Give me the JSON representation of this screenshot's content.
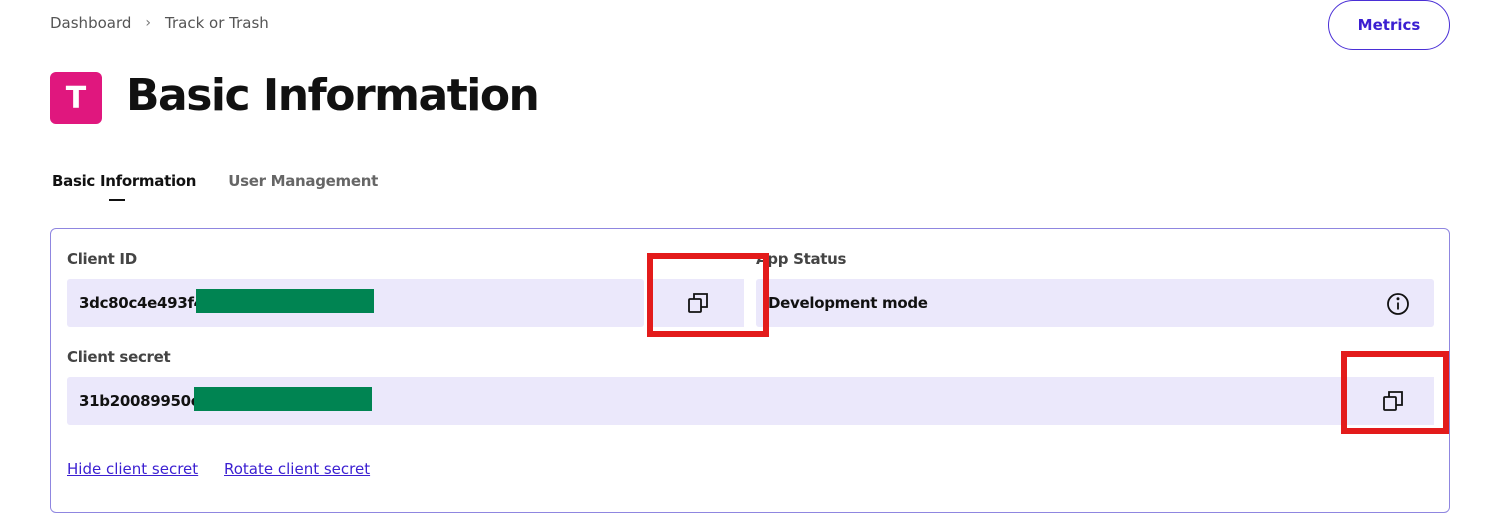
{
  "breadcrumb": {
    "items": [
      "Dashboard",
      "Track or Trash"
    ],
    "separator": "›"
  },
  "header": {
    "metrics_label": "Metrics",
    "app_initial": "T",
    "title": "Basic Information"
  },
  "tabs": [
    {
      "label": "Basic Information",
      "active": true
    },
    {
      "label": "User Management",
      "active": false
    }
  ],
  "fields": {
    "client_id": {
      "label": "Client ID",
      "value": "3dc80c4e493f4"
    },
    "app_status": {
      "label": "App Status",
      "value": "Development mode"
    },
    "client_secret": {
      "label": "Client secret",
      "value": "31b20089950e"
    }
  },
  "links": {
    "hide_secret": "Hide client secret",
    "rotate_secret": "Rotate client secret"
  },
  "icons": {
    "copy": "copy-icon",
    "info": "info-icon"
  },
  "colors": {
    "accent": "#3b1fd1",
    "app_badge": "#e0177e",
    "field_bg": "#ebe8fb",
    "redaction": "#008452",
    "highlight": "#e31b1b"
  }
}
